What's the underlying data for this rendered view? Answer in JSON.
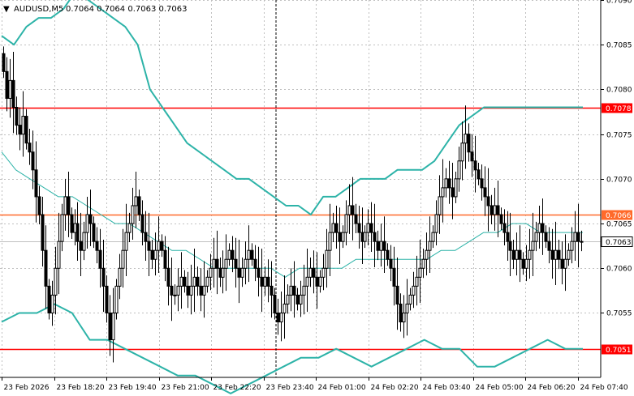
{
  "header": {
    "menu_glyph": "▼",
    "symbol_text": "AUDUSD,M5",
    "ohlc_text": "0.7064 0.7064 0.7063 0.7063"
  },
  "colors": {
    "candle": "#000000",
    "band": "#2db3a8",
    "level_red": "#ff0000",
    "level_orange": "#ff6a2a",
    "grid": "#c0c0c0",
    "price_pill": "#ffffff"
  },
  "chart_data": {
    "type": "candlestick",
    "symbol": "AUDUSD",
    "timeframe": "M5",
    "ylim": [
      0.70478,
      0.709
    ],
    "y_ticks": [
      0.709,
      0.7085,
      0.708,
      0.7075,
      0.707,
      0.7065,
      0.706,
      0.7055
    ],
    "x_labels": [
      "23 Feb 2026",
      "23 Feb 18:20",
      "23 Feb 19:40",
      "23 Feb 21:00",
      "23 Feb 22:20",
      "23 Feb 23:40",
      "24 Feb 01:00",
      "24 Feb 02:20",
      "24 Feb 03:40",
      "24 Feb 05:00",
      "24 Feb 06:20",
      "24 Feb 07:40"
    ],
    "grid": true,
    "levels": [
      {
        "label": "0.7078",
        "value": 0.7078,
        "color": "#ff0000"
      },
      {
        "label": "0.7066",
        "value": 0.7066,
        "color": "#ff6a2a"
      },
      {
        "label": "0.7051",
        "value": 0.7051,
        "color": "#ff0000"
      }
    ],
    "current_price": {
      "label": "0.7063",
      "value": 0.7063
    },
    "bar_count": 180,
    "closes": [
      0.7082,
      0.7079,
      0.7081,
      0.7078,
      0.7076,
      0.7075,
      0.7077,
      0.7074,
      0.7073,
      0.7071,
      0.7068,
      0.7066,
      0.7062,
      0.7058,
      0.7055,
      0.7057,
      0.706,
      0.7063,
      0.7066,
      0.7068,
      0.7066,
      0.7064,
      0.7065,
      0.7063,
      0.7062,
      0.7064,
      0.7066,
      0.7065,
      0.7063,
      0.7062,
      0.706,
      0.7058,
      0.7055,
      0.7052,
      0.7055,
      0.7058,
      0.706,
      0.7062,
      0.7064,
      0.7065,
      0.7067,
      0.7068,
      0.7066,
      0.7064,
      0.7063,
      0.7062,
      0.7061,
      0.7062,
      0.7063,
      0.7062,
      0.706,
      0.7058,
      0.7057,
      0.7057,
      0.7058,
      0.7059,
      0.7058,
      0.7057,
      0.7058,
      0.7059,
      0.7058,
      0.7057,
      0.7058,
      0.7059,
      0.706,
      0.7061,
      0.706,
      0.7059,
      0.706,
      0.7061,
      0.7062,
      0.7061,
      0.706,
      0.7059,
      0.706,
      0.7061,
      0.7062,
      0.7061,
      0.706,
      0.7059,
      0.7058,
      0.7059,
      0.7058,
      0.7057,
      0.7055,
      0.7054,
      0.7055,
      0.7056,
      0.7057,
      0.7058,
      0.7057,
      0.7056,
      0.7057,
      0.7058,
      0.7059,
      0.706,
      0.7059,
      0.7058,
      0.7059,
      0.706,
      0.7062,
      0.7064,
      0.7065,
      0.7064,
      0.7063,
      0.7064,
      0.7066,
      0.7067,
      0.7066,
      0.7065,
      0.7064,
      0.7063,
      0.7064,
      0.7065,
      0.7064,
      0.7063,
      0.7062,
      0.7063,
      0.7062,
      0.7061,
      0.706,
      0.7058,
      0.7056,
      0.7054,
      0.7055,
      0.7056,
      0.7057,
      0.7058,
      0.7059,
      0.706,
      0.7061,
      0.7062,
      0.7063,
      0.7064,
      0.7066,
      0.7068,
      0.7069,
      0.707,
      0.7069,
      0.7068,
      0.707,
      0.7072,
      0.7074,
      0.7075,
      0.7073,
      0.7072,
      0.7071,
      0.707,
      0.7069,
      0.7068,
      0.7067,
      0.7066,
      0.7067,
      0.7066,
      0.7065,
      0.7064,
      0.7063,
      0.7062,
      0.7061,
      0.7062,
      0.7061,
      0.706,
      0.7061,
      0.7062,
      0.7063,
      0.7064,
      0.7065,
      0.7064,
      0.7063,
      0.7062,
      0.7061,
      0.7062,
      0.7061,
      0.706,
      0.7061,
      0.7062,
      0.7063,
      0.7064,
      0.7063,
      0.7063
    ],
    "bollinger": {
      "upper": [
        [
          0.7086,
          0.7085
        ],
        [
          0.7087,
          0.7088
        ],
        [
          0.7088,
          0.7089
        ],
        [
          0.7091,
          0.709
        ],
        [
          0.7089,
          0.7088
        ],
        [
          0.7087,
          0.7085
        ],
        [
          0.708,
          0.7078
        ],
        [
          0.7076,
          0.7074
        ],
        [
          0.7073,
          0.7072
        ],
        [
          0.7071,
          0.707
        ],
        [
          0.707,
          0.7069
        ],
        [
          0.7068,
          0.7067
        ],
        [
          0.7067,
          0.7066
        ],
        [
          0.7068,
          0.7068
        ],
        [
          0.7069,
          0.707
        ],
        [
          0.707,
          0.707
        ],
        [
          0.7071,
          0.7071
        ],
        [
          0.7071,
          0.7072
        ],
        [
          0.7074,
          0.7076
        ],
        [
          0.7077,
          0.7078
        ],
        [
          0.7078,
          0.7078
        ],
        [
          0.7078,
          0.7078
        ],
        [
          0.7078,
          0.7078
        ],
        [
          0.7078,
          0.7078
        ]
      ],
      "middle": [
        [
          0.7073,
          0.7071
        ],
        [
          0.707,
          0.7069
        ],
        [
          0.7068,
          0.7068
        ],
        [
          0.7067,
          0.7066
        ],
        [
          0.7065,
          0.7065
        ],
        [
          0.7064,
          0.7063
        ],
        [
          0.7062,
          0.7062
        ],
        [
          0.7061,
          0.706
        ],
        [
          0.706,
          0.706
        ],
        [
          0.706,
          0.706
        ],
        [
          0.7059,
          0.706
        ],
        [
          0.706,
          0.706
        ],
        [
          0.706,
          0.7061
        ],
        [
          0.7061,
          0.7061
        ],
        [
          0.7061,
          0.7061
        ],
        [
          0.7061,
          0.7062
        ],
        [
          0.7062,
          0.7063
        ],
        [
          0.7064,
          0.7064
        ],
        [
          0.7065,
          0.7065
        ],
        [
          0.7064,
          0.7064
        ],
        [
          0.7064,
          0.7064
        ]
      ],
      "lower": [
        [
          0.7054,
          0.7055
        ],
        [
          0.7055,
          0.7056
        ],
        [
          0.7055,
          0.7052
        ],
        [
          0.7052,
          0.7051
        ],
        [
          0.705,
          0.7049
        ],
        [
          0.7048,
          0.7048
        ],
        [
          0.7047,
          0.7046
        ],
        [
          0.7047,
          0.7048
        ],
        [
          0.7049,
          0.705
        ],
        [
          0.705,
          0.7051
        ],
        [
          0.705,
          0.7049
        ],
        [
          0.705,
          0.7051
        ],
        [
          0.7052,
          0.7051
        ],
        [
          0.7051,
          0.7049
        ],
        [
          0.7049,
          0.705
        ],
        [
          0.7051,
          0.7052
        ],
        [
          0.7051,
          0.7051
        ]
      ]
    }
  }
}
